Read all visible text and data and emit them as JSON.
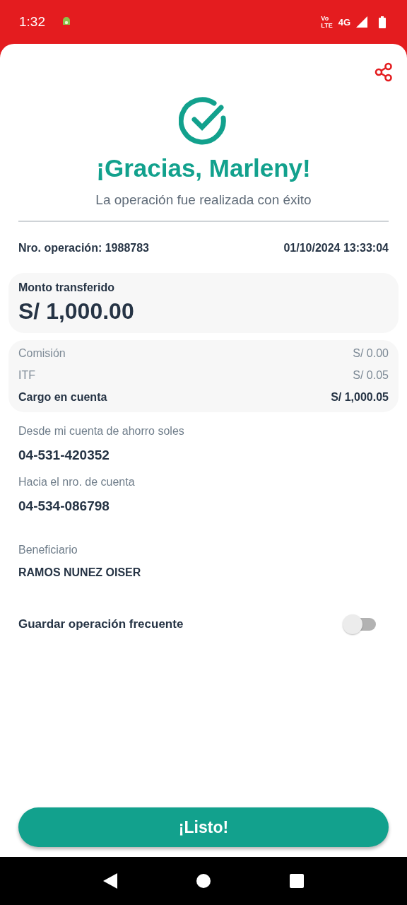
{
  "status_bar": {
    "time": "1:32",
    "volte_top": "Vo",
    "volte_bottom": "LTE",
    "network": "4G"
  },
  "header": {
    "title": "¡Gracias, Marleny!",
    "subtitle": "La operación fue realizada con éxito"
  },
  "operation": {
    "number": "Nro. operación: 1988783",
    "datetime": "01/10/2024 13:33:04"
  },
  "amount": {
    "label": "Monto transferido",
    "value": "S/ 1,000.00"
  },
  "charges": [
    {
      "kind": "fee",
      "label": "Comisión",
      "value": "S/ 0.00"
    },
    {
      "kind": "fee",
      "label": "ITF",
      "value": "S/ 0.05"
    },
    {
      "kind": "total",
      "label": "Cargo en cuenta",
      "value": "S/ 1,000.05"
    }
  ],
  "details": [
    {
      "kind": "account",
      "label": "Desde mi cuenta de ahorro soles",
      "value": "04-531-420352"
    },
    {
      "kind": "account",
      "label": "Hacia el nro. de cuenta",
      "value": "04-534-086798"
    },
    {
      "kind": "name",
      "label": "Beneficiario",
      "value": "RAMOS NUNEZ OISER"
    }
  ],
  "save_frequent": {
    "label": "Guardar operación frecuente",
    "on": false
  },
  "button": "¡Listo!"
}
